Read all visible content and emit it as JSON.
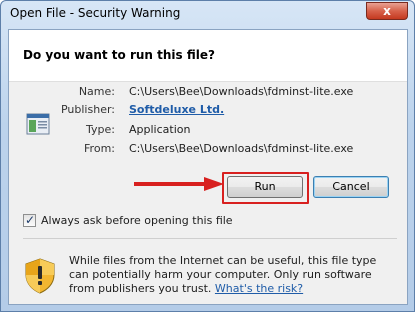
{
  "window": {
    "title": "Open File - Security Warning",
    "close_glyph": "x"
  },
  "question": "Do you want to run this file?",
  "file": {
    "name_label": "Name:",
    "name_value": "C:\\Users\\Bee\\Downloads\\fdminst-lite.exe",
    "publisher_label": "Publisher:",
    "publisher_value": "Softdeluxe Ltd.",
    "type_label": "Type:",
    "type_value": "Application",
    "from_label": "From:",
    "from_value": "C:\\Users\\Bee\\Downloads\\fdminst-lite.exe",
    "icon": "exe-file-icon"
  },
  "buttons": {
    "run": "Run",
    "cancel": "Cancel"
  },
  "checkbox": {
    "label": "Always ask before opening this file",
    "checked": true
  },
  "warning": {
    "icon": "security-shield-icon",
    "text": "While files from the Internet can be useful, this file type can potentially harm your computer. Only run software from publishers you trust.",
    "link": "What's the risk?"
  },
  "annotation": {
    "arrow_color": "#d8201f",
    "highlight_color": "#d8201f"
  }
}
